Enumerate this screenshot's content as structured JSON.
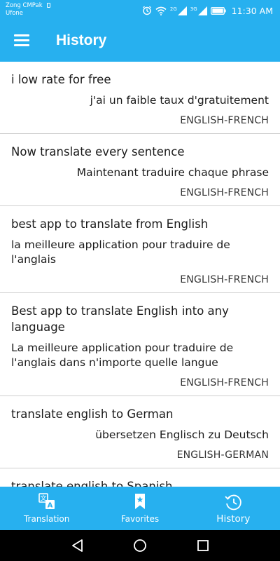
{
  "status_bar": {
    "carrier_line1": "Zong CMPak",
    "carrier_line2": "Ufone",
    "network_1": "2G",
    "network_2": "3G",
    "time": "11:30 AM",
    "icons": [
      "alarm-icon",
      "wifi-icon",
      "signal-icon",
      "signal-icon",
      "battery-icon"
    ]
  },
  "app_bar": {
    "title": "History"
  },
  "history": [
    {
      "source": "i low rate for free",
      "translation": "j'ai un faible taux d'gratuitement",
      "language": "ENGLISH-FRENCH",
      "align": "right"
    },
    {
      "source": "Now translate every sentence",
      "translation": "Maintenant traduire chaque phrase",
      "language": "ENGLISH-FRENCH",
      "align": "right"
    },
    {
      "source": "best app to translate from English",
      "translation": "la meilleure application pour traduire de l'anglais",
      "language": "ENGLISH-FRENCH",
      "align": "left"
    },
    {
      "source": "Best app to translate English into any language",
      "translation": "La meilleure application pour traduire de l'anglais dans n'importe quelle langue",
      "language": "ENGLISH-FRENCH",
      "align": "left"
    },
    {
      "source": "translate english to German",
      "translation": "übersetzen Englisch zu Deutsch",
      "language": "ENGLISH-GERMAN",
      "align": "right"
    },
    {
      "source": "translate english to Spanish",
      "translation": "",
      "language": "",
      "align": "right"
    }
  ],
  "bottom_nav": {
    "tabs": [
      {
        "label": "Translation",
        "icon": "translate-icon",
        "active": false
      },
      {
        "label": "Favorites",
        "icon": "bookmark-icon",
        "active": false
      },
      {
        "label": "History",
        "icon": "history-icon",
        "active": true
      }
    ]
  },
  "system_nav": {
    "buttons": [
      "back-icon",
      "home-icon",
      "recents-icon"
    ]
  },
  "colors": {
    "primary": "#27b0ef",
    "divider": "#cfcfcf",
    "system_nav_bg": "#000000"
  }
}
